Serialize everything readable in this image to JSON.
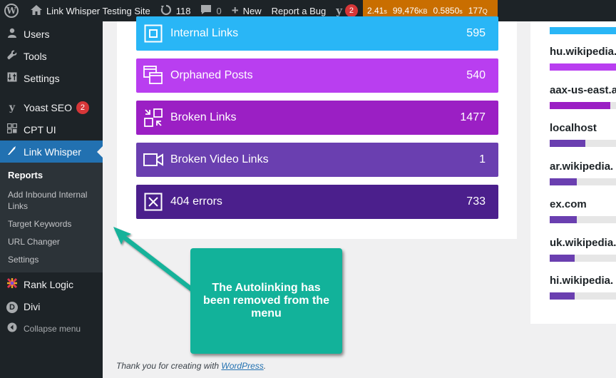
{
  "admin_bar": {
    "site_name": "Link Whisper Testing Site",
    "updates_count": "118",
    "comments_count": "0",
    "new_label": "New",
    "report_bug_label": "Report a Bug",
    "yoast_badge": "2",
    "qm": {
      "time": "2.41",
      "time_unit": "s",
      "memory": "99,476",
      "memory_unit": "KB",
      "db_time": "0.5850",
      "db_time_unit": "s",
      "queries": "177",
      "queries_unit": "Q"
    }
  },
  "sidebar": {
    "items": [
      {
        "label": "Users",
        "icon": "users-icon"
      },
      {
        "label": "Tools",
        "icon": "wrench-icon"
      },
      {
        "label": "Settings",
        "icon": "settings-icon"
      },
      {
        "label": "Yoast SEO",
        "icon": "yoast-icon",
        "badge": "2"
      },
      {
        "label": "CPT UI",
        "icon": "grid-icon"
      },
      {
        "label": "Link Whisper",
        "icon": "link-whisper-icon"
      }
    ],
    "submenu": [
      {
        "label": "Reports"
      },
      {
        "label": "Add Inbound Internal Links"
      },
      {
        "label": "Target Keywords"
      },
      {
        "label": "URL Changer"
      },
      {
        "label": "Settings"
      }
    ],
    "lower_items": [
      {
        "label": "Rank Logic",
        "icon": "rank-logic-icon"
      },
      {
        "label": "Divi",
        "icon": "divi-icon"
      }
    ],
    "collapse_label": "Collapse menu"
  },
  "stats": [
    {
      "label": "Internal Links",
      "count": "595",
      "color": "#29b6f6",
      "icon": "internal-links-icon"
    },
    {
      "label": "Orphaned Posts",
      "count": "540",
      "color": "#b93ef0",
      "icon": "orphaned-posts-icon"
    },
    {
      "label": "Broken Links",
      "count": "1477",
      "color": "#9b1fc4",
      "icon": "broken-links-icon"
    },
    {
      "label": "Broken Video Links",
      "count": "1",
      "color": "#6a3fb0",
      "icon": "video-icon"
    },
    {
      "label": "404 errors",
      "count": "733",
      "color": "#4b1f8c",
      "icon": "close-box-icon"
    }
  ],
  "domains": [
    {
      "name": "hu.wikipedia.",
      "fill": 1.0,
      "color": "#b93ef0"
    },
    {
      "name": "aax-us-east.a",
      "fill": 0.71,
      "color": "#9b1fc4"
    },
    {
      "name": "localhost",
      "fill": 0.42,
      "color": "#6a3fb0"
    },
    {
      "name": "ar.wikipedia.",
      "fill": 0.32,
      "color": "#6a3fb0"
    },
    {
      "name": "ex.com",
      "fill": 0.32,
      "color": "#6a3fb0"
    },
    {
      "name": "uk.wikipedia.",
      "fill": 0.29,
      "color": "#6a3fb0"
    },
    {
      "name": "hi.wikipedia.",
      "fill": 0.29,
      "color": "#6a3fb0"
    }
  ],
  "callout": {
    "text": "The Autolinking has been removed from the menu",
    "color": "#12b29a"
  },
  "footer": {
    "prefix": "Thank you for creating with ",
    "link": "WordPress",
    "suffix": "."
  }
}
